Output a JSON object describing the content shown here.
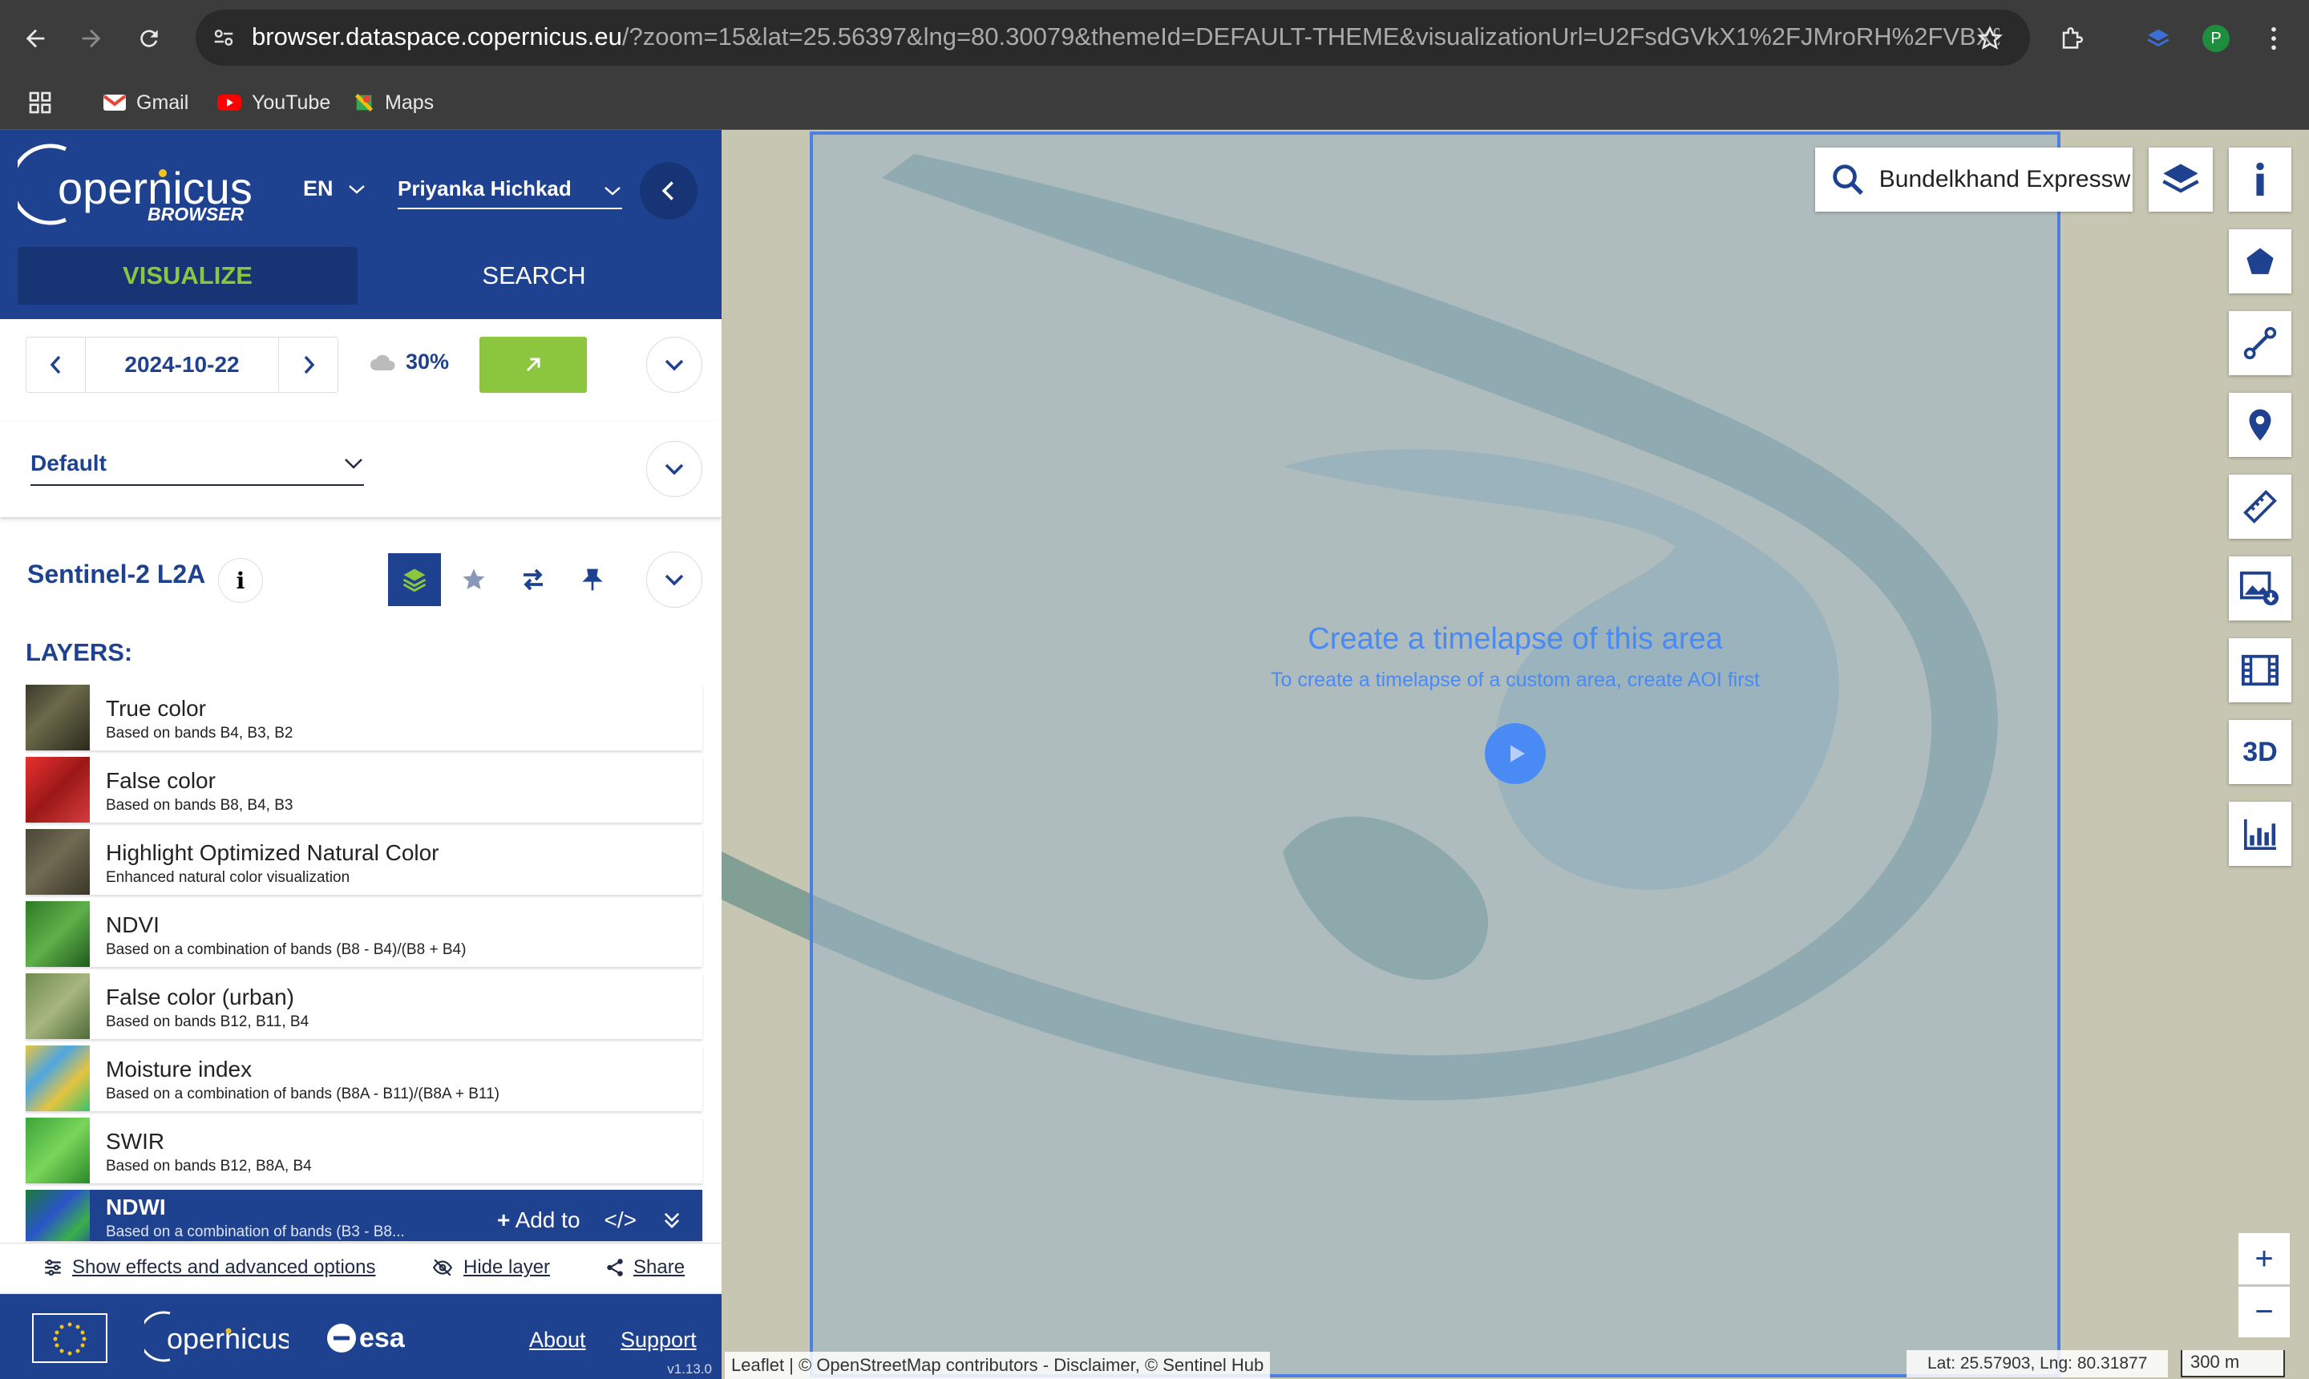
{
  "browser": {
    "url_host": "browser.dataspace.copernicus.eu",
    "url_rest": "/?zoom=15&lat=25.56397&lng=80.30079&themeId=DEFAULT-THEME&visualizationUrl=U2FsdGVkX1%2FJMroRH%2FVBX%2...",
    "profile_initial": "P",
    "bookmarks": [
      {
        "label": "Gmail",
        "icon": "gmail-icon"
      },
      {
        "label": "YouTube",
        "icon": "youtube-icon"
      },
      {
        "label": "Maps",
        "icon": "maps-icon"
      }
    ]
  },
  "app": {
    "logo_text": "BROWSER",
    "language": "EN",
    "user": "Priyanka Hichkad",
    "tabs": {
      "visualize": "VISUALIZE",
      "search": "SEARCH"
    }
  },
  "date_panel": {
    "date": "2024-10-22",
    "cloud": "30%"
  },
  "theme_panel": {
    "selected": "Default"
  },
  "collection": {
    "name": "Sentinel-2 L2A",
    "info": "i"
  },
  "layers": {
    "label": "LAYERS:",
    "items": [
      {
        "name": "True color",
        "desc": "Based on bands B4, B3, B2",
        "thumb": "#3b3a2a"
      },
      {
        "name": "False color",
        "desc": "Based on bands B8, B4, B3",
        "thumb": "#d42a2a"
      },
      {
        "name": "Highlight Optimized Natural Color",
        "desc": "Enhanced natural color visualization",
        "thumb": "#4a4536"
      },
      {
        "name": "NDVI",
        "desc": "Based on a combination of bands (B8 - B4)/(B8 + B4)",
        "thumb": "#2f7a26"
      },
      {
        "name": "False color (urban)",
        "desc": "Based on bands B12, B11, B4",
        "thumb": "#6e8b4d"
      },
      {
        "name": "Moisture index",
        "desc": "Based on a combination of bands (B8A - B11)/(B8A + B11)",
        "thumb": "#e5c440"
      },
      {
        "name": "SWIR",
        "desc": "Based on bands B12, B8A, B4",
        "thumb": "#3aa53a"
      }
    ],
    "selected": {
      "name": "NDWI",
      "desc": "Based on a combination of bands (B3 - B8...",
      "add_to": "Add to",
      "code": "</>",
      "thumb": "#1c7a3a"
    }
  },
  "options": {
    "effects": "Show effects and advanced options",
    "hide": "Hide layer",
    "share": "Share"
  },
  "footer": {
    "about": "About",
    "support": "Support",
    "version": "v1.13.0"
  },
  "map": {
    "search_value": "Bundelkhand Expressw",
    "timelapse_title": "Create a timelapse of this area",
    "timelapse_sub": "To create a timelapse of a custom area, create AOI first",
    "attribution": "Leaflet | © OpenStreetMap contributors - Disclaimer, © Sentinel Hub",
    "coords": "Lat: 25.57903, Lng: 80.31877",
    "scale": "300 m",
    "tool_3d": "3D",
    "zoom_in": "+",
    "zoom_out": "−"
  }
}
